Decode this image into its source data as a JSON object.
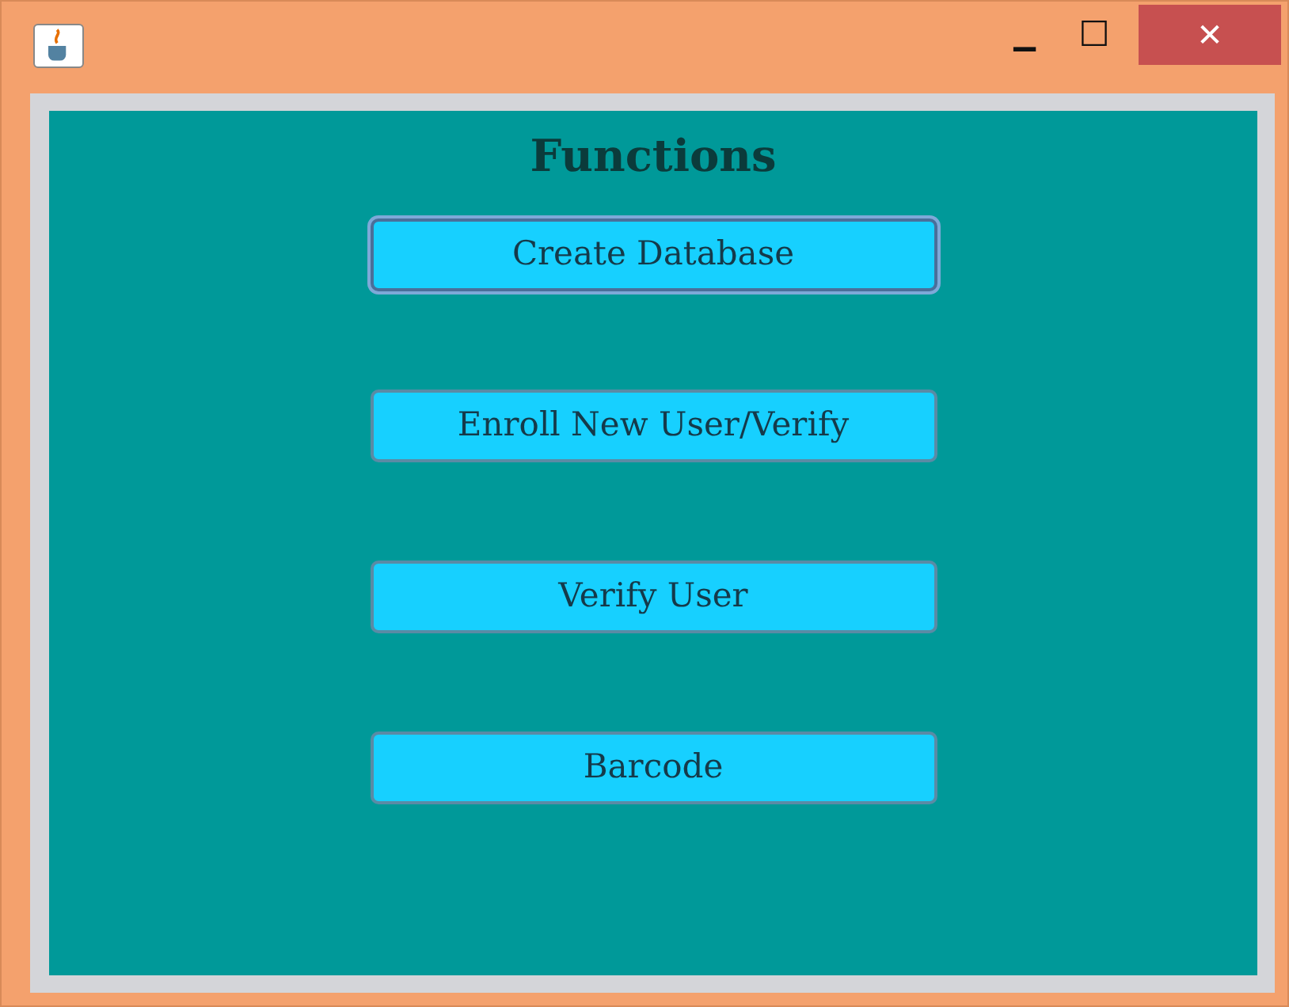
{
  "window": {
    "minimize": "▁",
    "maximize": "☐",
    "close": "✕"
  },
  "heading": "Functions",
  "buttons": [
    {
      "label": "Create Database",
      "focused": true
    },
    {
      "label": "Enroll New User/Verify",
      "focused": false
    },
    {
      "label": "Verify User",
      "focused": false
    },
    {
      "label": "Barcode",
      "focused": false
    }
  ]
}
